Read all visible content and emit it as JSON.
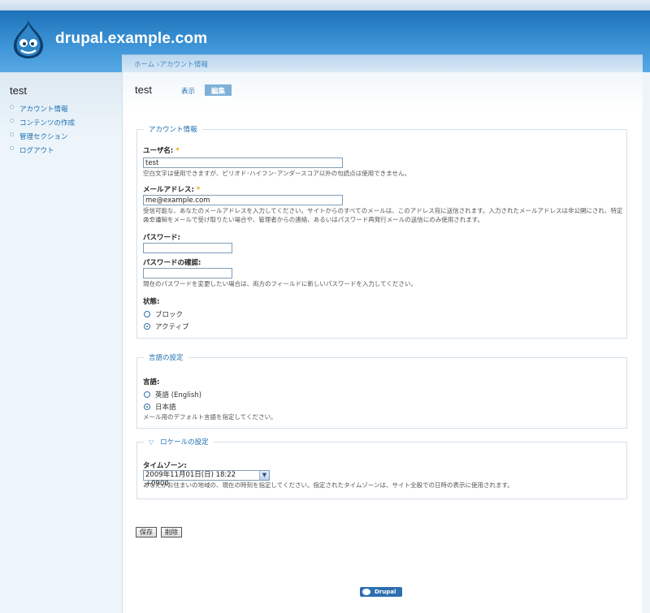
{
  "site": {
    "name": "drupal.example.com"
  },
  "sidebar": {
    "title": "test",
    "items": [
      {
        "label": "アカウント情報"
      },
      {
        "label": "コンテンツの作成"
      },
      {
        "label": "管理セクション"
      },
      {
        "label": "ログアウト"
      }
    ]
  },
  "breadcrumb": {
    "home": "ホーム",
    "separator": "›",
    "current": "アカウント情報"
  },
  "page": {
    "title": "test",
    "tabs": {
      "view": "表示",
      "edit": "編集"
    }
  },
  "account": {
    "legend": "アカウント情報",
    "username_label": "ユーザ名:",
    "required_mark": "*",
    "username_value": "test",
    "username_desc": "空白文字は使用できますが、ピリオド･ハイフン･アンダースコア以外の句読点は使用できません。",
    "email_label": "メールアドレス:",
    "email_value": "me@example.com",
    "email_desc_1": "受信可能な、あなたのメールアドレスを入力してください。サイトからのすべてのメールは、このアドレス宛に送信されます。入力されたメールアドレスは非公開にされ、特定のニュー",
    "email_desc_2": "スや通知をメールで受け取りたい場合や、管理者からの連絡、あるいはパスワード再発行メールの送信にのみ使用されます。",
    "password_label": "パスワード:",
    "password_confirm_label": "パスワードの確認:",
    "password_desc": "現在のパスワードを変更したい場合は、両方のフィールドに新しいパスワードを入力してください。",
    "status_label": "状態:",
    "status_blocked": "ブロック",
    "status_active": "アクティブ"
  },
  "language": {
    "legend": "言語の設定",
    "label": "言語:",
    "option_english": "英語 (English)",
    "option_japanese": "日本語",
    "desc": "メール用のデフォルト言語を指定してください。"
  },
  "locale": {
    "legend": "ロケールの設定",
    "timezone_label": "タイムゾーン:",
    "timezone_value": "2009年11月01日(日) 18:22 +0900",
    "timezone_desc": "あなたがお住まいの地域の、現在の時刻を指定してください。指定されたタイムゾーンは、サイト全般での日時の表示に使用されます。"
  },
  "buttons": {
    "save": "保存",
    "delete": "削除"
  },
  "footer": {
    "powered": "Drupal"
  }
}
